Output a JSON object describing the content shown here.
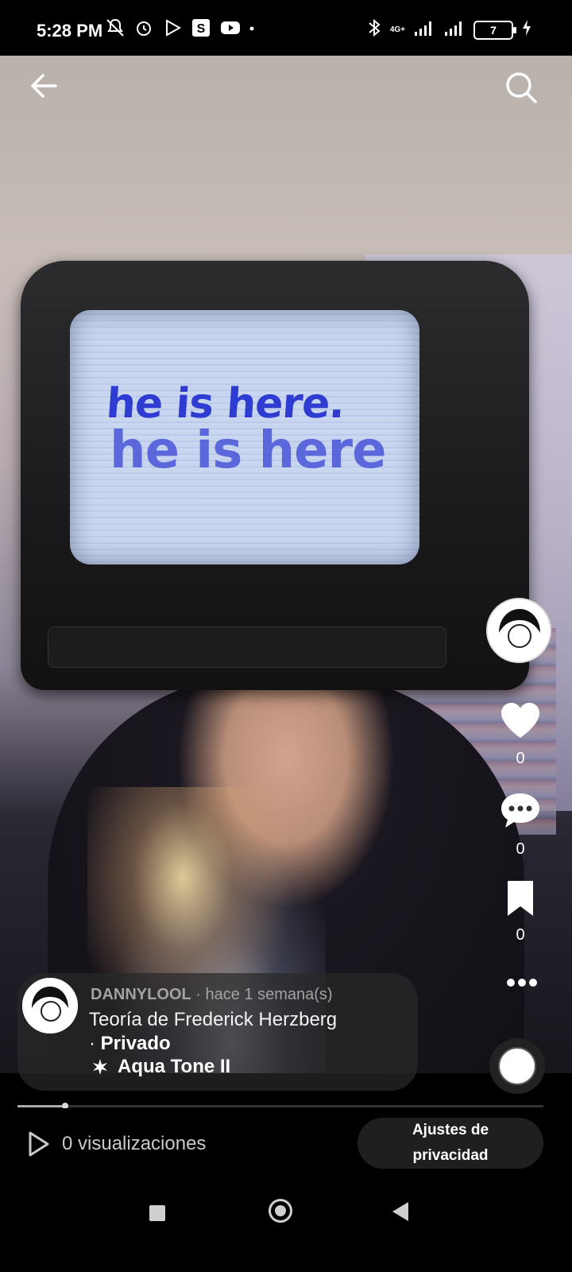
{
  "status_bar": {
    "time": "5:28 PM",
    "network": "4G+",
    "battery": "7"
  },
  "video": {
    "screen_text_line1": "he is here.",
    "screen_text_line2": "he is here"
  },
  "side_actions": {
    "likes": "0",
    "comments": "0",
    "saves": "0"
  },
  "post": {
    "username": "DANNYLOOL",
    "time_ago": "hace 1 semana(s)",
    "separator": "·",
    "title": "Teoría de Frederick Herzberg",
    "privacy": "Privado",
    "sound": "Aqua Tone II"
  },
  "progress": {
    "fraction": 0.09
  },
  "bottom": {
    "views": "0 visualizaciones",
    "privacy_button_line1": "Ajustes de",
    "privacy_button_line2": "privacidad"
  },
  "icons": {
    "back": "arrow-left-icon",
    "search": "search-icon",
    "like": "heart-icon",
    "comment": "comment-icon",
    "save": "bookmark-icon",
    "more": "more-icon",
    "play": "play-icon"
  }
}
